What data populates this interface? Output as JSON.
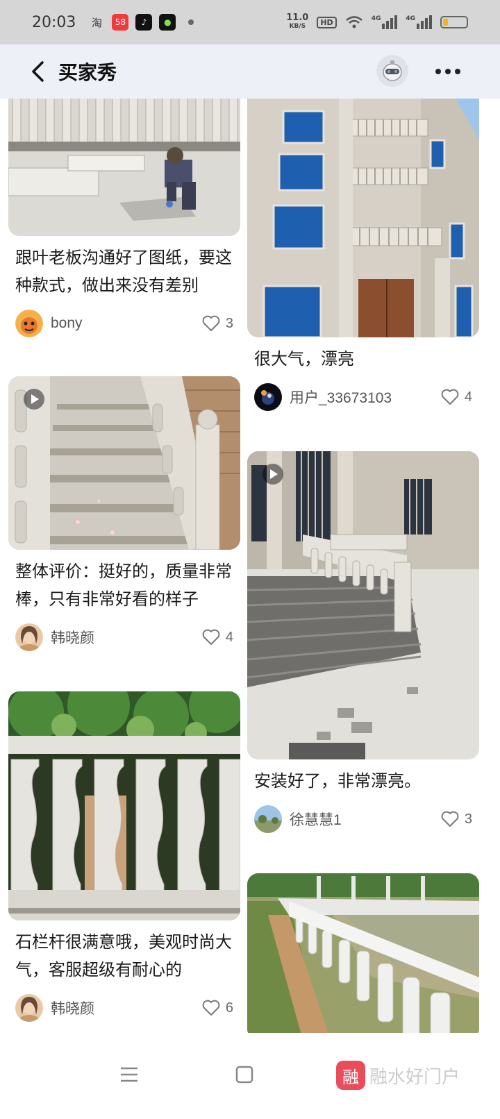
{
  "status_bar": {
    "time": "20:03",
    "speed_value": "11.0",
    "speed_unit": "KB/S",
    "hd": "HD",
    "net1": "4G",
    "net2": "4G",
    "battery_level": 0.22,
    "battery_color": "#f4b41a",
    "apps": [
      {
        "icon": "taobao-icon",
        "glyph": "淘",
        "color": "#ffffff"
      },
      {
        "icon": "58-icon",
        "glyph": "58",
        "color": "#ef3b3b"
      },
      {
        "icon": "douyin-icon",
        "glyph": "♪",
        "color": "#111111"
      },
      {
        "icon": "green-app-icon",
        "glyph": "●",
        "color": "#111111"
      }
    ]
  },
  "header": {
    "title": "买家秀",
    "back_icon": "chevron-left-icon",
    "avatar_icon": "robot-icon",
    "more_icon": "more-dots-icon",
    "background": "#eef0f8"
  },
  "feed": {
    "left": [
      {
        "caption": "跟叶老板沟通好了图纸，要这种款式，做出来没有差别",
        "user": "bony",
        "likes": "3",
        "video": false,
        "scene": "worker"
      },
      {
        "caption": "整体评价：挺好的，质量非常棒，只有非常好看的样子",
        "user": "韩晓颜",
        "likes": "4",
        "video": true,
        "scene": "stairs"
      },
      {
        "caption": "石栏杆很满意哦，美观时尚大气，客服超级有耐心的",
        "user": "韩晓颜",
        "likes": "6",
        "video": false,
        "scene": "balusters"
      }
    ],
    "right": [
      {
        "caption": "很大气，漂亮",
        "user": "用户_33673103",
        "likes": "4",
        "video": false,
        "scene": "building"
      },
      {
        "caption": "安装好了，非常漂亮。",
        "user": "徐慧慧1",
        "likes": "3",
        "video": true,
        "scene": "entrance"
      },
      {
        "caption": "",
        "user": "",
        "likes": "",
        "video": false,
        "scene": "pool"
      }
    ]
  },
  "nav": {
    "menu_icon": "menu-icon",
    "home_icon": "square-home-icon",
    "watermark_logo": "融",
    "watermark_text": "融水好门户"
  }
}
